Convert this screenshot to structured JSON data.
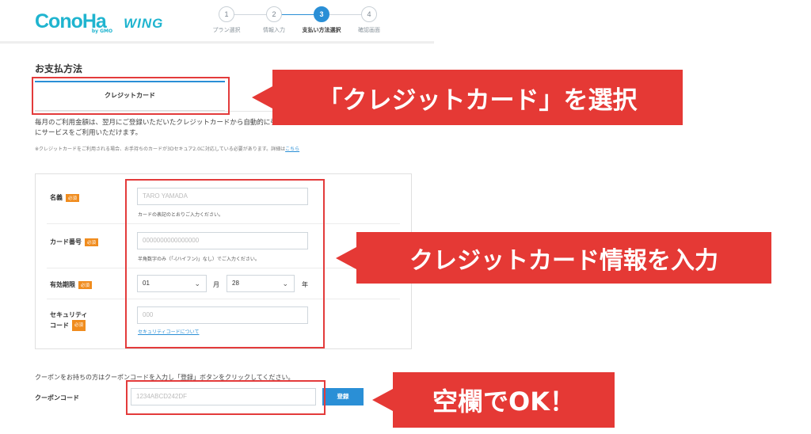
{
  "header": {
    "logo_text": "ConoHa",
    "logo_sub": "by GMO",
    "logo_product": "WING",
    "steps": [
      {
        "num": "1",
        "label": "プラン選択"
      },
      {
        "num": "2",
        "label": "情報入力"
      },
      {
        "num": "3",
        "label": "支払い方法選択"
      },
      {
        "num": "4",
        "label": "確認画面"
      }
    ],
    "current_step": 3
  },
  "payment": {
    "title": "お支払方法",
    "tab_label": "クレジットカード",
    "description": "毎月のご利用金額は、翌月にご登録いただいたクレジットカードから自動的に引き落とされます。カード情報ご登録後すぐにサービスをご利用いただけます。",
    "note_text": "※クレジットカードをご利用される場合、お手持ちのカードが3Dセキュア2.0に対応している必要があります。詳細は",
    "note_link": "こちら"
  },
  "form": {
    "required_badge": "必須",
    "name": {
      "label": "名義",
      "placeholder": "TARO YAMADA",
      "hint": "カードの表記のとおりご入力ください。"
    },
    "card_number": {
      "label": "カード番号",
      "placeholder": "0000000000000000",
      "hint": "半角数字のみ（「-(ハイフン)」なし）でご入力ください。"
    },
    "expiry": {
      "label": "有効期限",
      "month_value": "01",
      "month_unit": "月",
      "year_value": "28",
      "year_unit": "年"
    },
    "security": {
      "label_line1": "セキュリティ",
      "label_line2": "コード",
      "placeholder": "000",
      "link": "セキュリティコードについて"
    }
  },
  "coupon": {
    "text": "クーポンをお持ちの方はクーポンコードを入力し「登録」ボタンをクリックしてください。",
    "label": "クーポンコード",
    "placeholder": "1234ABCD242DF",
    "button": "登録"
  },
  "annotations": {
    "callout1": "「クレジットカード」を選択",
    "callout2": "クレジットカード情報を入力",
    "callout3": "空欄でOK！",
    "color": "#e53935"
  },
  "icons": {
    "chevron": "chevron-down-icon"
  }
}
